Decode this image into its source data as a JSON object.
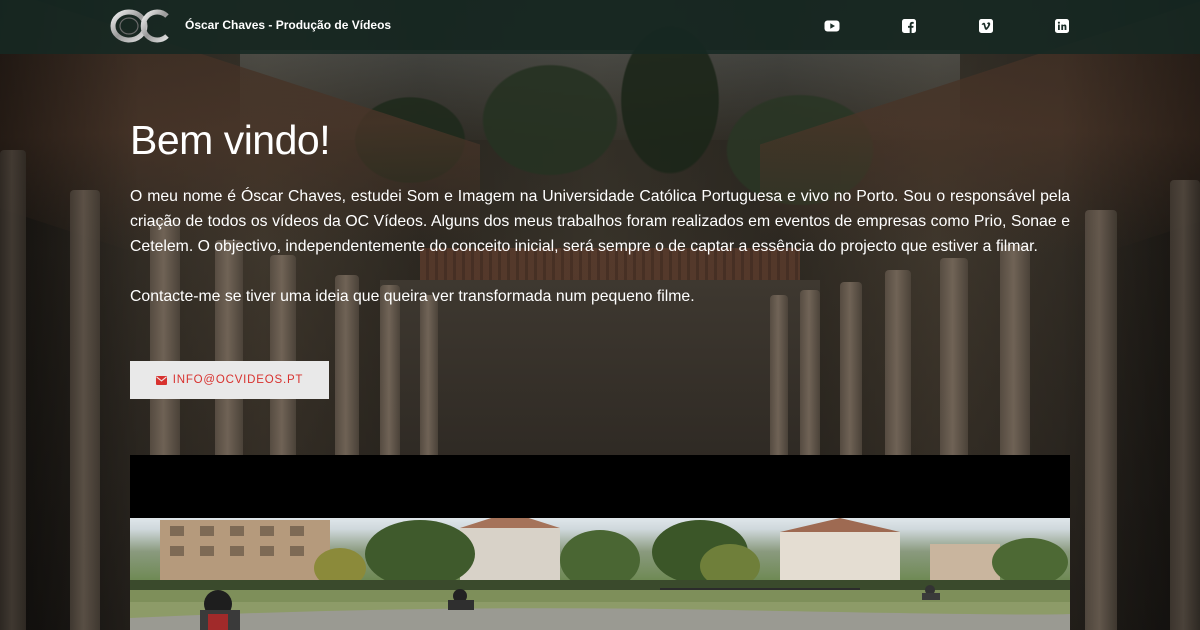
{
  "header": {
    "brand_name": "Óscar Chaves - Produção de Vídeos",
    "logo_text": "OC",
    "social_links": [
      {
        "name": "youtube-icon"
      },
      {
        "name": "facebook-icon"
      },
      {
        "name": "vimeo-icon"
      },
      {
        "name": "linkedin-icon"
      }
    ]
  },
  "hero": {
    "title": "Bem vindo!",
    "paragraph": "O meu nome é Óscar Chaves, estudei Som e Imagem na Universidade Católica Portuguesa e vivo no Porto. Sou o responsável pela criação de todos os vídeos da OC Vídeos. Alguns dos meus trabalhos foram realizados em eventos de empresas como Prio, Sonae e Cetelem. O objectivo, independentemente do conceito inicial, será sempre o de captar a essência do projecto que estiver a filmar.",
    "contact_text": "Contacte-me se tiver uma ideia que queira ver transformada num pequeno filme.",
    "email_button_label": "INFO@OCVIDEOS.PT",
    "email_icon": "envelope-icon"
  },
  "colors": {
    "navbar_bg": "#162822",
    "accent": "#d8322f",
    "button_bg": "#e9e9e9",
    "text": "#ffffff"
  }
}
